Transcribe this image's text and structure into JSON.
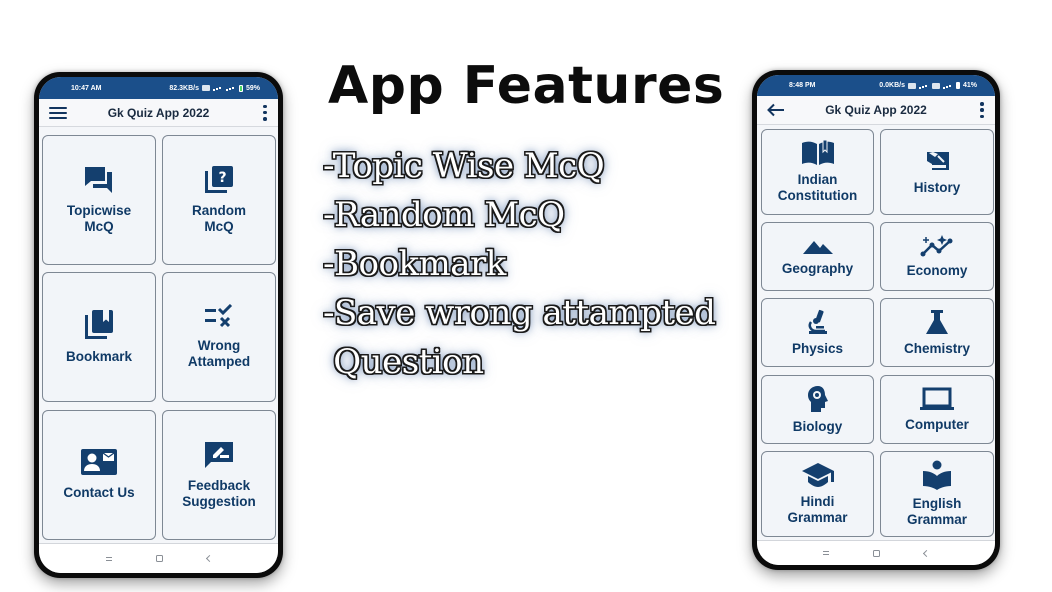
{
  "headline": "App Features",
  "features": [
    "-Topic Wise McQ",
    "-Random McQ",
    "-Bookmark",
    "-Save wrong attampted",
    " Question"
  ],
  "colors": {
    "status_bar": "#1b4f8a",
    "icon_and_label": "#103a66",
    "card_background": "#f2f5f9",
    "card_border": "#7e8894"
  },
  "left_phone": {
    "status": {
      "time": "10:47 AM",
      "network_speed": "82.3KB/s",
      "battery": "59%"
    },
    "app_bar": {
      "title": "Gk Quiz App 2022",
      "left_icon": "hamburger-menu-icon",
      "right_icon": "more-vert-icon"
    },
    "tiles": [
      {
        "label": "Topicwise\nMcQ",
        "icon": "forum-icon"
      },
      {
        "label": "Random\nMcQ",
        "icon": "quiz-icon"
      },
      {
        "label": "Bookmark",
        "icon": "bookmarks-icon"
      },
      {
        "label": "Wrong\nAttamped",
        "icon": "rule-icon"
      },
      {
        "label": "Contact Us",
        "icon": "contact-mail-icon"
      },
      {
        "label": "Feedback\nSuggestion",
        "icon": "rate-review-icon"
      }
    ]
  },
  "right_phone": {
    "status": {
      "time": "8:48 PM",
      "network_speed": "0.0KB/s",
      "battery": "41%"
    },
    "app_bar": {
      "title": "Gk Quiz App 2022",
      "left_icon": "back-arrow-icon",
      "right_icon": "more-vert-icon"
    },
    "tiles": [
      {
        "label": "Indian\nConstitution",
        "icon": "book-icon"
      },
      {
        "label": "History",
        "icon": "history-edu-icon"
      },
      {
        "label": "Geography",
        "icon": "terrain-icon"
      },
      {
        "label": "Economy",
        "icon": "trend-chart-icon"
      },
      {
        "label": "Physics",
        "icon": "microscope-icon"
      },
      {
        "label": "Chemistry",
        "icon": "flask-icon"
      },
      {
        "label": "Biology",
        "icon": "psychology-icon"
      },
      {
        "label": "Computer",
        "icon": "laptop-icon"
      },
      {
        "label": "Hindi\nGrammar",
        "icon": "school-icon"
      },
      {
        "label": "English\nGrammar",
        "icon": "local-library-icon"
      }
    ]
  },
  "nav_bar": {
    "buttons": [
      "recents",
      "home",
      "back"
    ]
  }
}
